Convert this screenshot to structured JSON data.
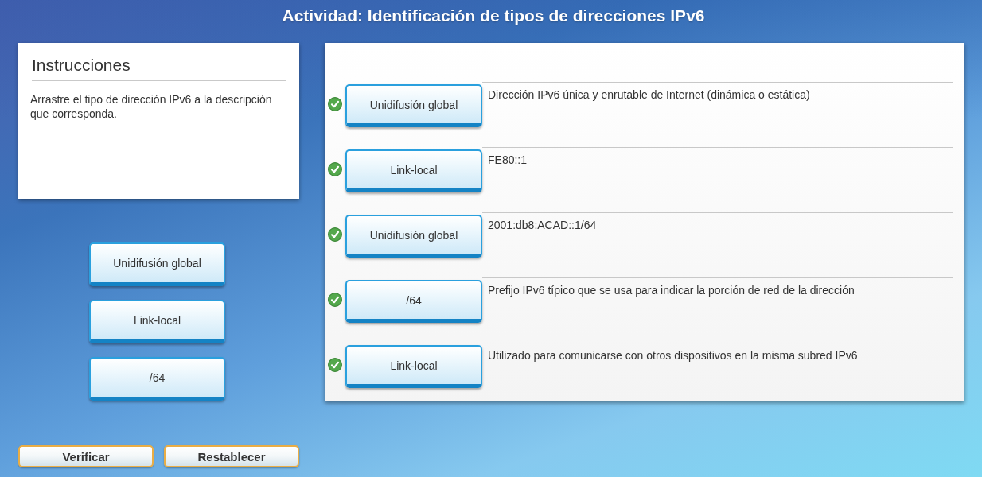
{
  "title": "Actividad: Identificación de tipos de direcciones IPv6",
  "instructions": {
    "heading": "Instrucciones",
    "text": "Arrastre el tipo de dirección IPv6 a la descripción que corresponda."
  },
  "source_tiles": [
    {
      "label": "Unidifusión global"
    },
    {
      "label": "Link-local"
    },
    {
      "label": "/64"
    }
  ],
  "matches": [
    {
      "tile": "Unidifusión global",
      "description": "Dirección IPv6 única y enrutable de Internet (dinámica o estática)",
      "correct": true
    },
    {
      "tile": "Link-local",
      "description": "FE80::1",
      "correct": true
    },
    {
      "tile": "Unidifusión global",
      "description": "2001:db8:ACAD::1/64",
      "correct": true
    },
    {
      "tile": "/64",
      "description": "Prefijo IPv6 típico que se usa para indicar la porción de red de la dirección",
      "correct": true
    },
    {
      "tile": "Link-local",
      "description": "Utilizado para comunicarse con otros dispositivos en la misma subred IPv6",
      "correct": true
    }
  ],
  "buttons": [
    {
      "label": "Verificar"
    },
    {
      "label": "Restablecer"
    }
  ]
}
